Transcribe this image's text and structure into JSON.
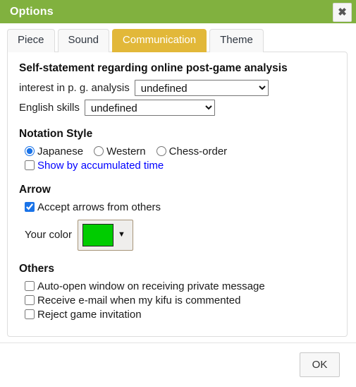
{
  "window": {
    "title": "Options",
    "close_icon": "close-icon",
    "close_glyph": "✖",
    "header_color": "#81b13f"
  },
  "tabs": {
    "active_index": 2,
    "active_color": "#e2b839",
    "items": [
      {
        "label": "Piece"
      },
      {
        "label": "Sound"
      },
      {
        "label": "Communication"
      },
      {
        "label": "Theme"
      }
    ]
  },
  "sections": {
    "self_statement": {
      "heading": "Self-statement regarding online post-game analysis",
      "interest": {
        "label": "interest in p. g. analysis",
        "value": "undefined",
        "options": [
          "undefined"
        ]
      },
      "english": {
        "label": "English skills",
        "value": "undefined",
        "options": [
          "undefined"
        ]
      }
    },
    "notation_style": {
      "heading": "Notation Style",
      "selected": "Japanese",
      "options": [
        {
          "label": "Japanese",
          "checked": true
        },
        {
          "label": "Western",
          "checked": false
        },
        {
          "label": "Chess-order",
          "checked": false
        }
      ],
      "accumulated_time": {
        "label": "Show by accumulated time",
        "checked": false,
        "color": "#0000ff"
      }
    },
    "arrow": {
      "heading": "Arrow",
      "accept_arrows": {
        "label": "Accept arrows from others",
        "checked": true
      },
      "your_color": {
        "label": "Your color",
        "value": "#00cc00",
        "caret_glyph": "▼"
      }
    },
    "others": {
      "heading": "Others",
      "items": [
        {
          "label": "Auto-open window on receiving private message",
          "checked": false
        },
        {
          "label": "Receive e-mail when my kifu is commented",
          "checked": false
        },
        {
          "label": "Reject game invitation",
          "checked": false
        }
      ]
    }
  },
  "footer": {
    "ok_label": "OK"
  }
}
